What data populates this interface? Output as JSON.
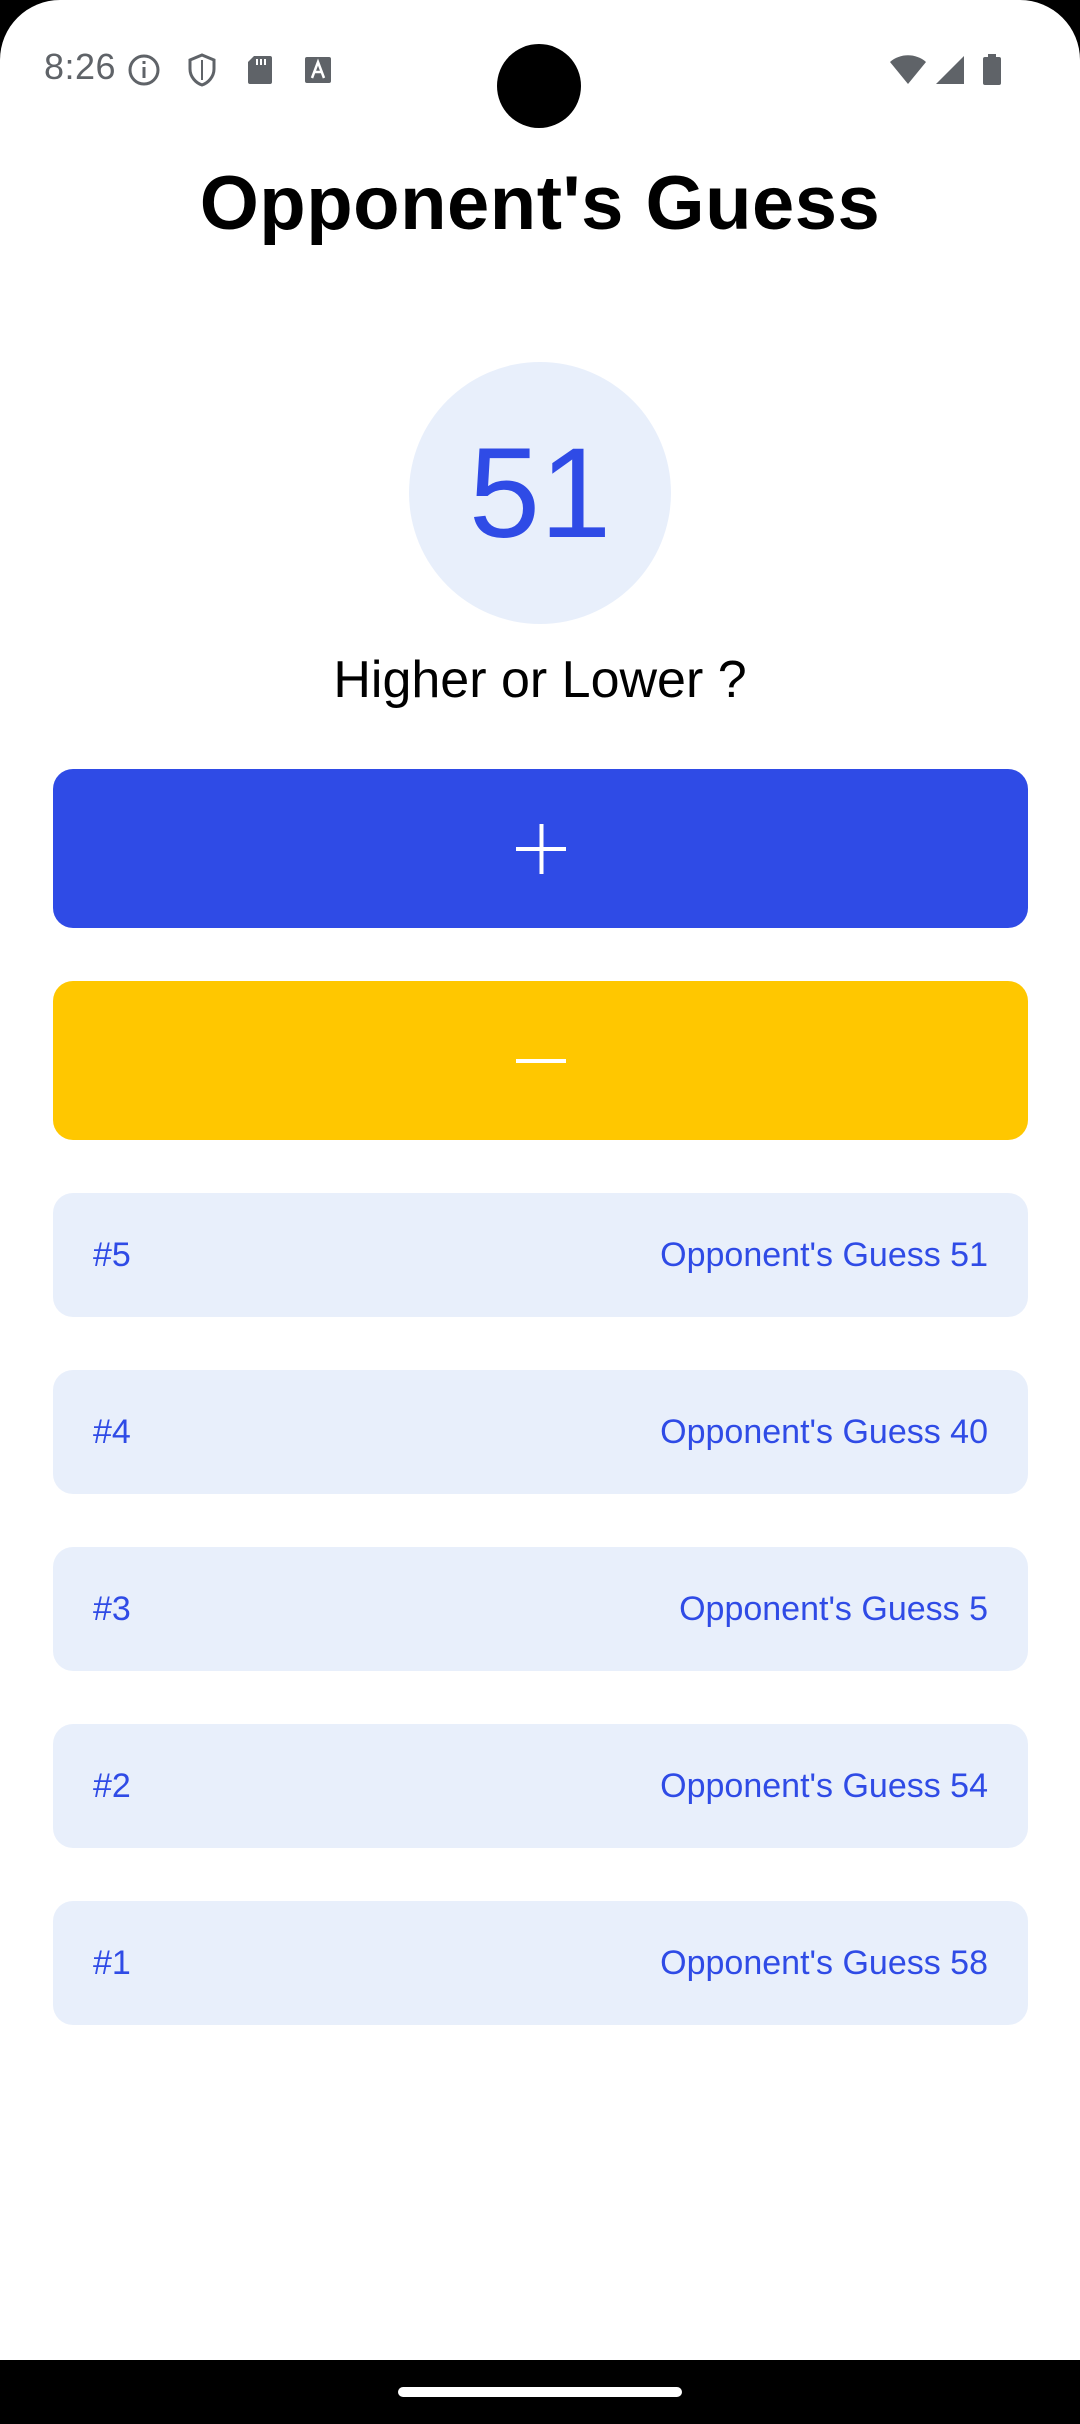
{
  "status_bar": {
    "time": "8:26",
    "icons_left": [
      "info-icon",
      "shield-icon",
      "sd-card-icon",
      "keyboard-a-icon"
    ],
    "icons_right": [
      "wifi-icon",
      "signal-icon",
      "battery-icon"
    ]
  },
  "header": {
    "title": "Opponent's Guess"
  },
  "game": {
    "current_guess": "51",
    "prompt": "Higher or Lower ?",
    "higher_button_icon": "plus-icon",
    "lower_button_icon": "minus-icon"
  },
  "log": {
    "items": [
      {
        "index": "#5",
        "text": "Opponent's Guess 51"
      },
      {
        "index": "#4",
        "text": "Opponent's Guess 40"
      },
      {
        "index": "#3",
        "text": "Opponent's Guess 5"
      },
      {
        "index": "#2",
        "text": "Opponent's Guess 54"
      },
      {
        "index": "#1",
        "text": "Opponent's Guess 58"
      }
    ]
  },
  "colors": {
    "primary": "#2f4be6",
    "accent": "#ffc700",
    "surface": "#e8effb"
  }
}
